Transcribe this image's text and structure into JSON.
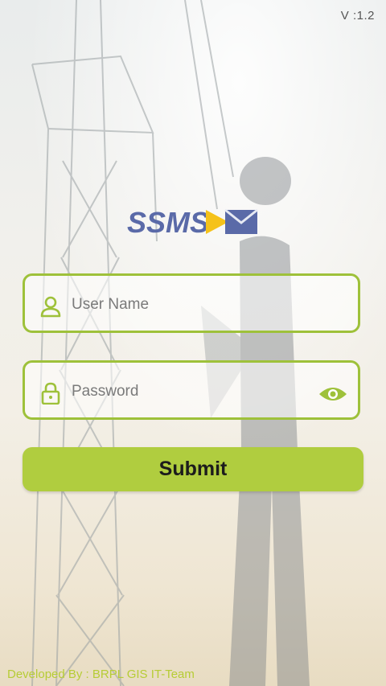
{
  "app": {
    "version": "V :1.2",
    "logo_text": "SSMS"
  },
  "login": {
    "username_placeholder": "User Name",
    "password_placeholder": "Password",
    "submit_label": "Submit"
  },
  "footer": {
    "credit": "Developed By : BRPL GIS IT-Team"
  },
  "colors": {
    "accent": "#9ec13a",
    "button": "#b0cd3f",
    "logo_blue": "#5a6aa8",
    "logo_yellow": "#f5c21a",
    "footer_text": "#b6cc35"
  },
  "icons": {
    "user_field": "user-icon",
    "password_field": "lock-icon",
    "password_toggle": "eye-icon"
  }
}
